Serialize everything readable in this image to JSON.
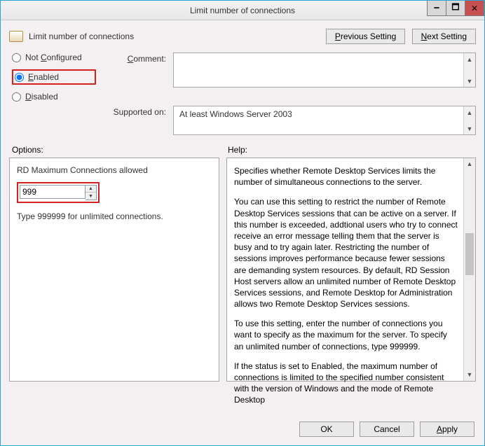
{
  "window": {
    "title": "Limit number of connections"
  },
  "header": {
    "title": "Limit number of connections",
    "prev_btn_pre": "P",
    "prev_btn_rest": "revious Setting",
    "next_btn_pre": "N",
    "next_btn_rest": "ext Setting"
  },
  "state": {
    "not_configured_pre": "Not ",
    "not_configured_u": "C",
    "not_configured_rest": "onfigured",
    "enabled_u": "E",
    "enabled_rest": "nabled",
    "disabled_u": "D",
    "disabled_rest": "isabled",
    "comment_label_u": "C",
    "comment_label_rest": "omment:",
    "supported_label": "Supported on:",
    "supported_value": "At least Windows Server 2003"
  },
  "labels": {
    "options": "Options:",
    "help": "Help:"
  },
  "options": {
    "field_label": "RD Maximum Connections allowed",
    "value": "999",
    "note": "Type 999999 for unlimited connections."
  },
  "help": {
    "p1": "Specifies whether Remote Desktop Services limits the number of simultaneous connections to the server.",
    "p2": "You can use this setting to restrict the number of Remote Desktop Services sessions that can be active on a server. If this number is exceeded, addtional users who try to connect receive an error message telling them that the server is busy and to try again later. Restricting the number of sessions improves performance because fewer sessions are demanding system resources. By default, RD Session Host servers allow an unlimited number of Remote Desktop Services sessions, and Remote Desktop for Administration allows two Remote Desktop Services sessions.",
    "p3": "To use this setting, enter the number of connections you want to specify as the maximum for the server. To specify an unlimited number of connections, type 999999.",
    "p4": "If the status is set to Enabled, the maximum number of connections is limited to the specified number consistent with the version of Windows and the mode of Remote Desktop"
  },
  "buttons": {
    "ok": "OK",
    "cancel": "Cancel",
    "apply_u": "A",
    "apply_rest": "pply"
  }
}
